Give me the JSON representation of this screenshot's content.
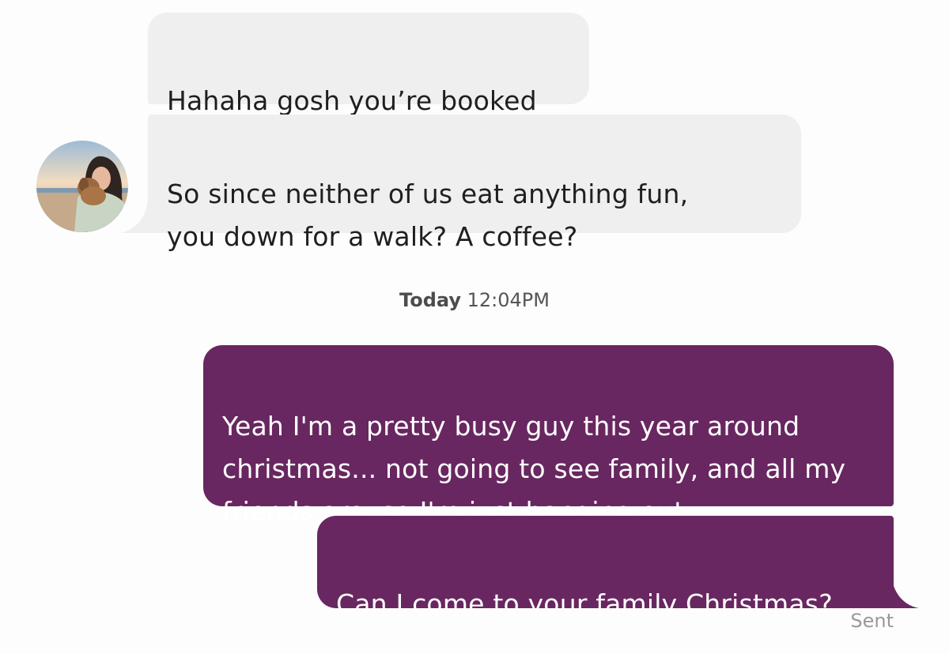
{
  "messages": [
    {
      "from": "them",
      "text": "Hahaha gosh you’re booked"
    },
    {
      "from": "them",
      "text": "So since neither of us eat anything fun,\nyou down for a walk? A coffee?"
    },
    {
      "from": "me",
      "text": "Yeah I'm a pretty busy guy this year around\nchristmas... not going to see family, and all my\nfriends are, so I'm just hanging out"
    },
    {
      "from": "me",
      "text": "Can I come to your family Christmas?"
    }
  ],
  "timestamp": {
    "day": "Today",
    "time": "12:04PM"
  },
  "status": "Sent",
  "colors": {
    "outgoing_bubble": "#682760",
    "incoming_bubble": "#efeff0"
  }
}
